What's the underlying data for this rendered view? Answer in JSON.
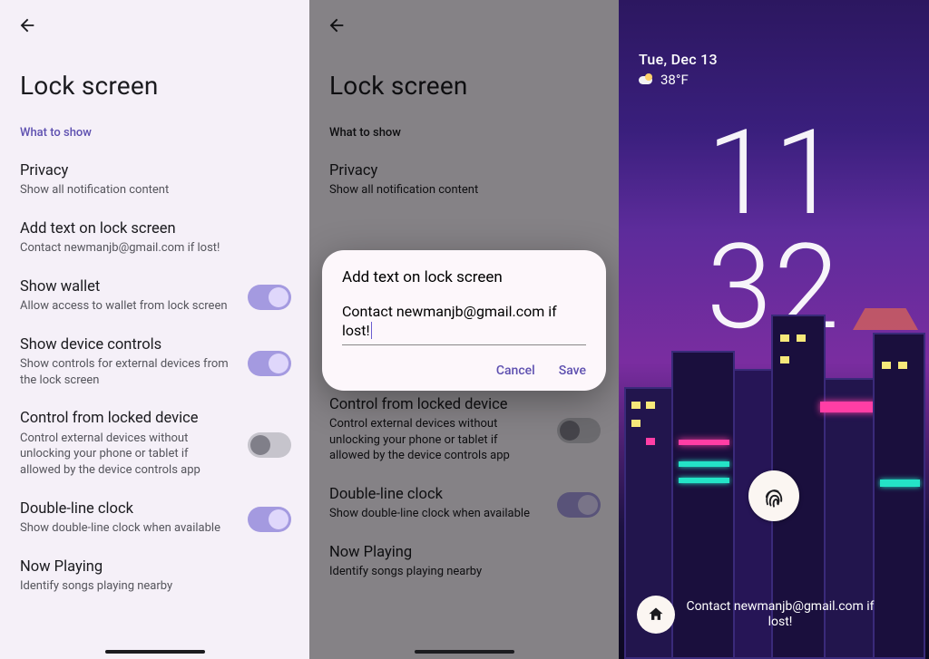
{
  "page": {
    "title": "Lock screen",
    "section": "What to show"
  },
  "items": {
    "privacy": {
      "title": "Privacy",
      "sub": "Show all notification content"
    },
    "addtext": {
      "title": "Add text on lock screen",
      "sub": "Contact newmanjb@gmail.com if lost!"
    },
    "wallet": {
      "title": "Show wallet",
      "sub": "Allow access to wallet from lock screen",
      "on": true
    },
    "controls": {
      "title": "Show device controls",
      "sub": "Show controls for external devices from the lock screen",
      "on": true
    },
    "cfld": {
      "title": "Control from locked device",
      "sub": "Control external devices without unlocking your phone or tablet if allowed by the device controls app",
      "on": false
    },
    "dlc": {
      "title": "Double-line clock",
      "sub": "Show double-line clock when available",
      "on": true
    },
    "np": {
      "title": "Now Playing",
      "sub": "Identify songs playing nearby"
    }
  },
  "dialog": {
    "title": "Add text on lock screen",
    "value": "Contact newmanjb@gmail.com if lost!",
    "cancel": "Cancel",
    "save": "Save"
  },
  "lockscreen": {
    "date": "Tue, Dec 13",
    "temp": "38°F",
    "clock_top": "11",
    "clock_bottom": "32",
    "message": "Contact newmanjb@gmail.com if lost!"
  }
}
